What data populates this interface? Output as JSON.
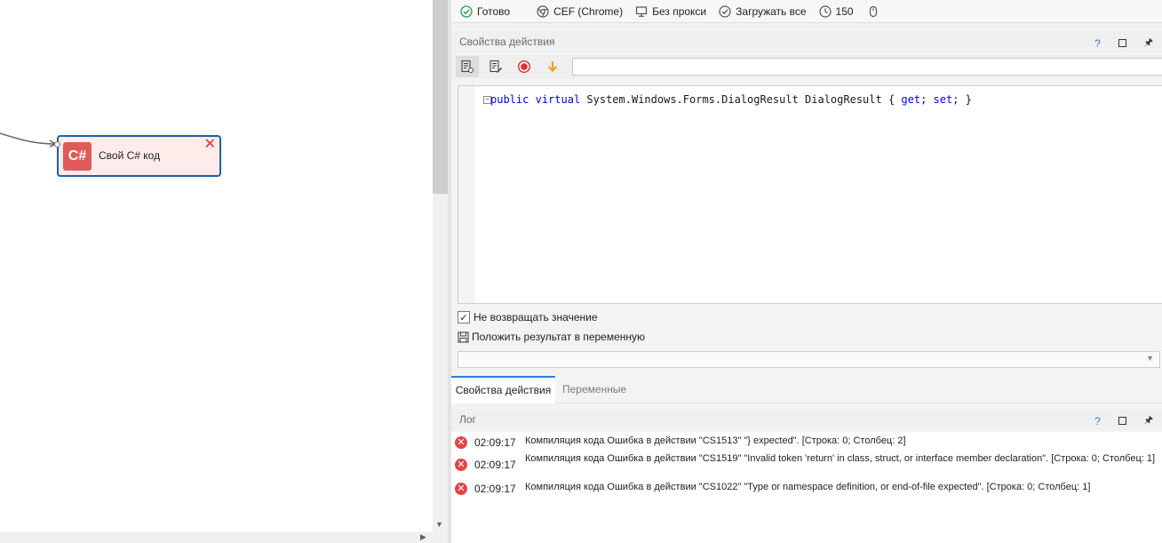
{
  "canvas": {
    "node": {
      "badge": "C#",
      "label": "Свой C# код",
      "close": "✕"
    }
  },
  "statusbar": {
    "ready": "Готово",
    "browser": "CEF (Chrome)",
    "proxy": "Без прокси",
    "load": "Загружать все",
    "timeout": "150"
  },
  "action_panel": {
    "title": "Свойства действия",
    "help": "?",
    "editor": {
      "code_parts": [
        "public",
        " ",
        "virtual",
        " System.Windows.Forms.DialogResult DialogResult { ",
        "get",
        "; ",
        "set",
        "; }"
      ]
    },
    "no_return_label": "Не возвращать значение",
    "no_return_checked": "✓",
    "save_result_label": "Положить результат в переменную",
    "combo_value": ""
  },
  "tabs": [
    {
      "label": "Свойства действия",
      "active": true
    },
    {
      "label": "Переменные",
      "active": false
    }
  ],
  "log": {
    "title": "Лог",
    "help": "?",
    "entries": [
      {
        "icon": "✕",
        "time": "02:09:17",
        "message": "Компиляция кода  Ошибка в действии \"CS1513\" \"} expected\". [Строка: 0; Столбец: 2]"
      },
      {
        "icon": "✕",
        "time": "02:09:17",
        "message": "Компиляция кода  Ошибка в действии \"CS1519\" \"Invalid token 'return' in class, struct, or interface member declaration\". [Строка: 0; Столбец: 1]"
      },
      {
        "icon": "✕",
        "time": "02:09:17",
        "message": "Компиляция кода  Ошибка в действии \"CS1022\" \"Type or namespace definition, or end-of-file expected\". [Строка: 0; Столбец: 1]"
      }
    ]
  },
  "colors": {
    "accent": "#2f7bd8",
    "node_border": "#1f5fa8",
    "node_badge": "#e05a5a",
    "error": "#e04545",
    "record": "#e03030",
    "download": "#f0a020"
  }
}
